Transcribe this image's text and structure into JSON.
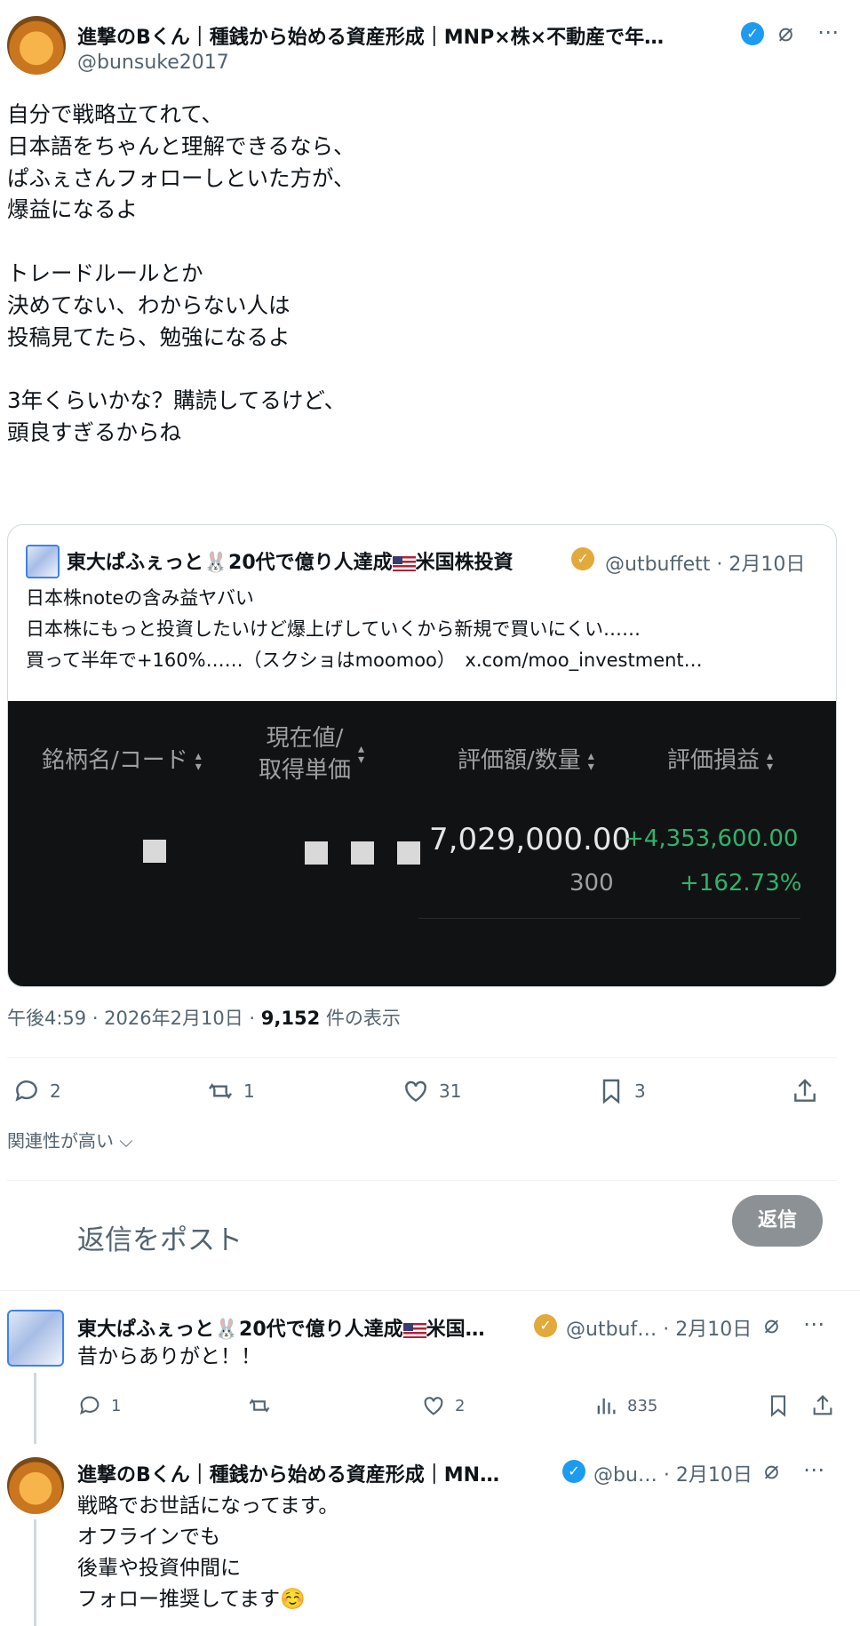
{
  "main_post": {
    "author_name": "進撃のBくん｜種銭から始める資産形成｜MNP×株×不動産で年…",
    "author_handle": "@bunsuke2017",
    "body": "自分で戦略立てれて、\n日本語をちゃんと理解できるなら、\nぱふぇさんフォローしといた方が、\n爆益になるよ\n\nトレードルールとか\n決めてない、わからない人は\n投稿見てたら、勉強になるよ\n\n3年くらいかな？購読してるけど、\n頭良すぎるからね",
    "timestamp": "午後4:59 · 2026年2月10日 · ",
    "views_count": "9,152",
    "views_label": " 件の表示",
    "actions": {
      "replies": "2",
      "reposts": "1",
      "likes": "31",
      "bookmarks": "3"
    }
  },
  "quote": {
    "author_name_a": "東大ぱふぇっと",
    "author_name_b": "20代で億り人達成",
    "author_name_c": "米国株投資",
    "handle_date": "@utbuffett · 2月10日",
    "lines": [
      "日本株noteの含み益ヤバい",
      "日本株にもっと投資したいけど爆上げしていくから新規で買いにくい……",
      "買って半年で+160%……（スクショはmoomoo）　x.com/moo_investment…"
    ],
    "table": {
      "headers": [
        "銘柄名/コード",
        "現在値/\n取得単価",
        "評価額/数量",
        "評価損益"
      ],
      "market_value": "7,029,000.00",
      "quantity": "300",
      "pl_amount": "+4,353,600.00",
      "pl_percent": "+162.73%"
    }
  },
  "relevance_label": "関連性が高い",
  "reply_box": {
    "placeholder": "返信をポスト",
    "button_label": "返信"
  },
  "replies": [
    {
      "author_name_a": "東大ぱふぇっと",
      "author_name_b": "20代で億り人達成",
      "author_name_c": "米国…",
      "handle_date": "@utbuf… · 2月10日",
      "body": "昔からありがと！！",
      "actions": {
        "replies": "1",
        "reposts": "",
        "likes": "2",
        "views": "835"
      }
    },
    {
      "author_name": "進撃のBくん｜種銭から始める資産形成｜MN…",
      "handle_date": "@bu… · 2月10日",
      "body": "戦略でお世話になってます。\nオフラインでも\n後輩や投資仲間に\nフォロー推奨してます☺️"
    }
  ],
  "colors": {
    "accent": "#1d9bf0",
    "gain": "#2fb36b",
    "dark_panel": "#111213"
  }
}
